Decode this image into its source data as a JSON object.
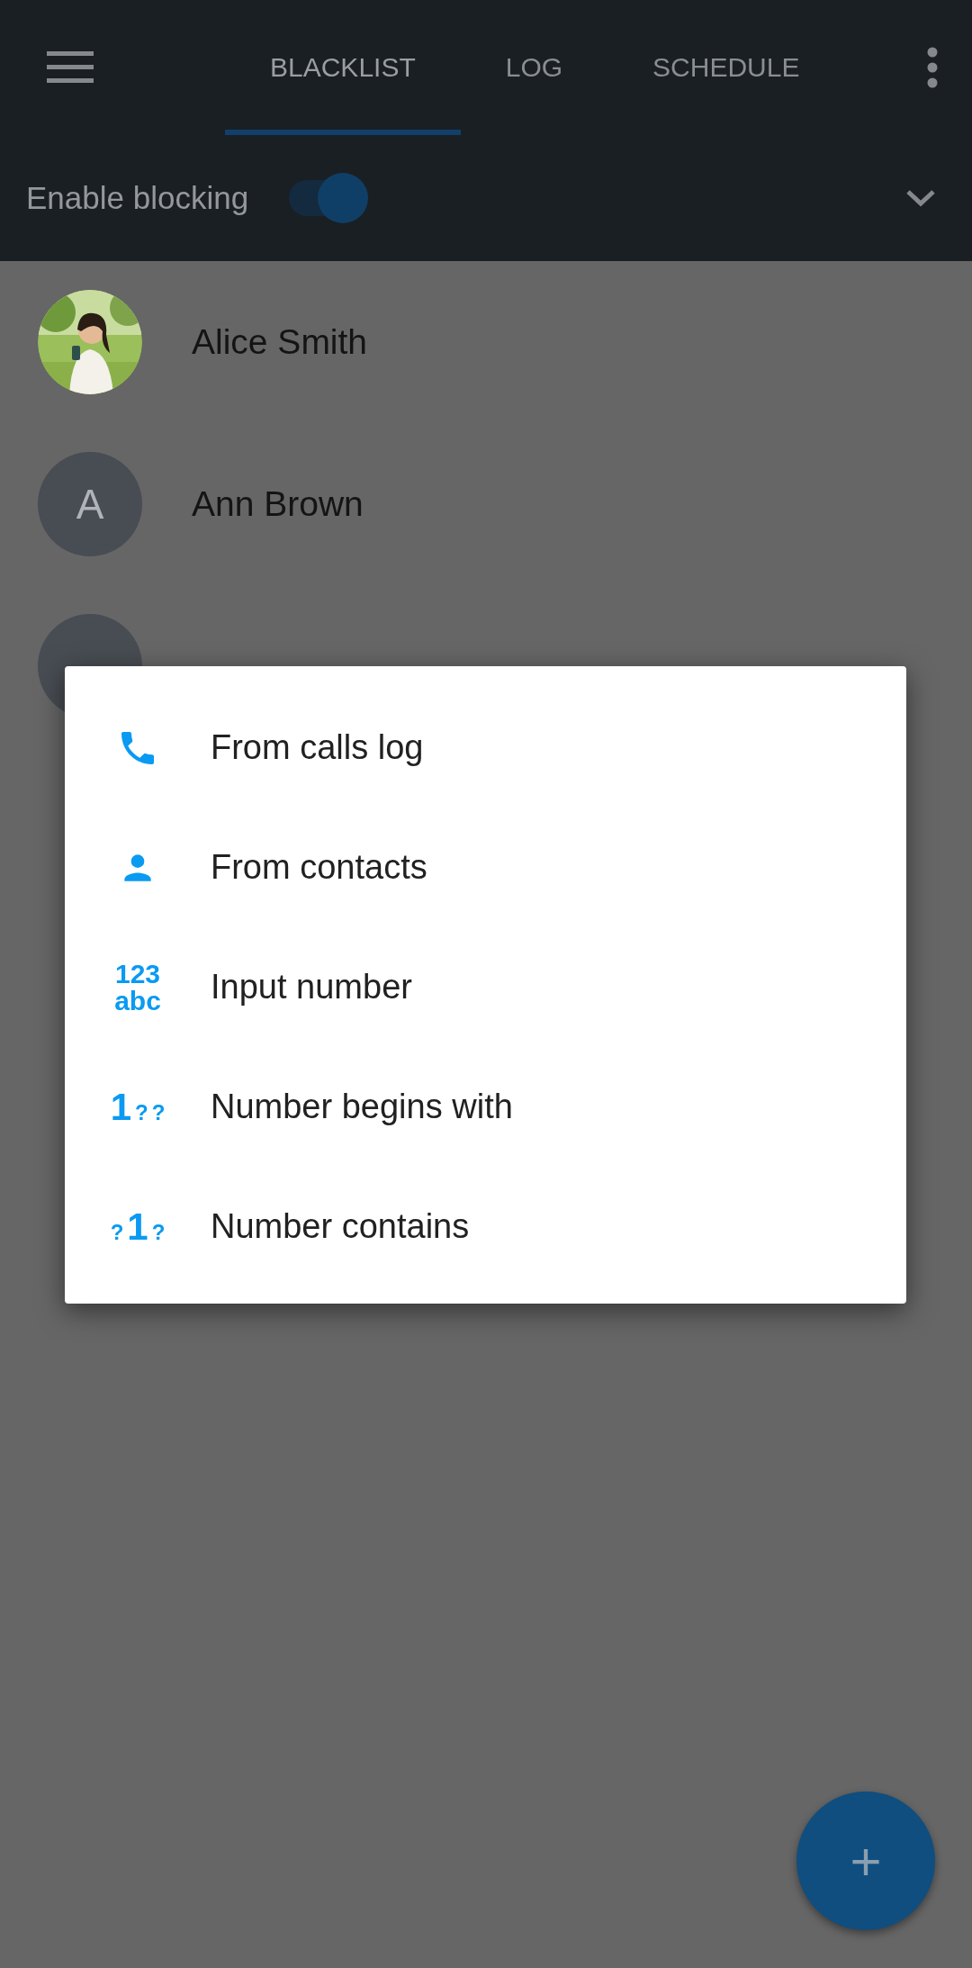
{
  "tabs": [
    {
      "label": "BLACKLIST",
      "selected": true
    },
    {
      "label": "LOG",
      "selected": false
    },
    {
      "label": "SCHEDULE",
      "selected": false
    }
  ],
  "blocking": {
    "label": "Enable blocking",
    "on": true
  },
  "contacts": [
    {
      "name": "Alice Smith"
    },
    {
      "name": "Ann Brown",
      "avatar": {
        "kind": "letter",
        "letter": "A"
      }
    },
    {
      "avatar": {
        "kind": "blank"
      }
    }
  ],
  "menu": [
    {
      "label": "From calls log",
      "kind": "phone"
    },
    {
      "label": "From contacts",
      "kind": "person"
    },
    {
      "label": "Input number",
      "kind": "stacked",
      "icon_lines": [
        "123",
        "abc"
      ]
    },
    {
      "label": "Number begins with",
      "kind": "glyphs",
      "icon_parts": [
        {
          "text": "1",
          "large": true
        },
        {
          "text": "?",
          "large": false
        },
        {
          "text": "?",
          "large": false
        }
      ]
    },
    {
      "label": "Number contains",
      "kind": "glyphs",
      "icon_parts": [
        {
          "text": "?",
          "large": false
        },
        {
          "text": "1",
          "large": true
        },
        {
          "text": "?",
          "large": false
        }
      ]
    }
  ],
  "fab": {
    "symbol": "+"
  }
}
